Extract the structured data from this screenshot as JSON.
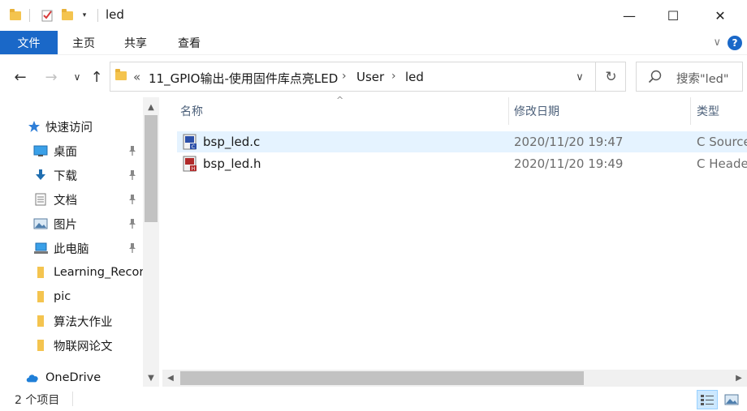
{
  "window": {
    "title": "led",
    "minimize_glyph": "—",
    "maximize_glyph": "☐",
    "close_glyph": "✕"
  },
  "ribbon": {
    "tabs": [
      {
        "label": "文件",
        "active": true
      },
      {
        "label": "主页"
      },
      {
        "label": "共享"
      },
      {
        "label": "查看"
      }
    ],
    "expand_glyph": "∨",
    "help_glyph": "?"
  },
  "nav": {
    "back_glyph": "←",
    "forward_glyph": "→",
    "recent_glyph": "∨",
    "up_glyph": "↑"
  },
  "address": {
    "overflow": "«",
    "crumbs": [
      "11_GPIO输出-使用固件库点亮LED",
      "User",
      "led"
    ],
    "separator": "›",
    "dropdown_glyph": "∨",
    "refresh_glyph": "↻"
  },
  "search": {
    "placeholder": "搜索\"led\""
  },
  "sidebar": {
    "items": [
      {
        "label": "快速访问",
        "icon": "star-icon",
        "pinned": false
      },
      {
        "label": "桌面",
        "icon": "desktop-icon",
        "pinned": true
      },
      {
        "label": "下载",
        "icon": "download-icon",
        "pinned": true
      },
      {
        "label": "文档",
        "icon": "document-icon",
        "pinned": true
      },
      {
        "label": "图片",
        "icon": "picture-icon",
        "pinned": true
      },
      {
        "label": "此电脑",
        "icon": "computer-icon",
        "pinned": true
      },
      {
        "label": "Learning_Record",
        "icon": "folder-icon",
        "pinned": false
      },
      {
        "label": "pic",
        "icon": "folder-icon",
        "pinned": false
      },
      {
        "label": "算法大作业",
        "icon": "folder-icon",
        "pinned": false
      },
      {
        "label": "物联网论文",
        "icon": "folder-icon",
        "pinned": false
      },
      {
        "label": "OneDrive",
        "icon": "cloud-icon",
        "pinned": false
      }
    ],
    "pin_glyph": "📌"
  },
  "columns": {
    "name": "名称",
    "date": "修改日期",
    "type": "类型",
    "sort_glyph": "^"
  },
  "files": [
    {
      "name": "bsp_led.c",
      "date": "2020/11/20 19:47",
      "type": "C Source",
      "icon": "c-source-file-icon",
      "selected": true
    },
    {
      "name": "bsp_led.h",
      "date": "2020/11/20 19:49",
      "type": "C Header",
      "icon": "c-header-file-icon",
      "selected": false
    }
  ],
  "status": {
    "count": "2 个项目"
  },
  "colors": {
    "accent": "#1a68c8",
    "selection": "#e5f3ff",
    "header_text": "#4c607a"
  }
}
